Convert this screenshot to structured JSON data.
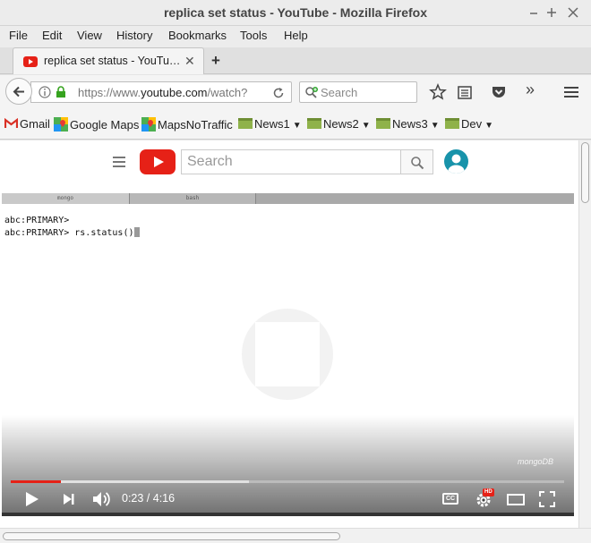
{
  "window": {
    "title": "replica set status - YouTube - Mozilla Firefox"
  },
  "menu": {
    "items": [
      "File",
      "Edit",
      "View",
      "History",
      "Bookmarks",
      "Tools",
      "Help"
    ]
  },
  "tab": {
    "label": "replica set status - YouTu…",
    "close": "✕",
    "new_tab": "+"
  },
  "nav": {
    "url_prefix": "https://www.",
    "url_host": "youtube.com",
    "url_rest": "/watch?",
    "search_placeholder": "Search",
    "overflow": "»"
  },
  "bookmarks": {
    "items": [
      "Gmail",
      "Google Maps",
      "MapsNoTraffic",
      "News1",
      "News2",
      "News3",
      "Dev"
    ]
  },
  "youtube": {
    "search_placeholder": "Search"
  },
  "terminal": {
    "tabs": [
      "mongo",
      "bash"
    ],
    "lines": [
      "abc:PRIMARY>",
      "abc:PRIMARY> rs.status()"
    ]
  },
  "player": {
    "current_time": "0:23",
    "duration": "4:16",
    "time_display": "0:23 / 4:16",
    "played_fraction": 0.09,
    "buffered_fraction": 0.43,
    "watermark": "mongoDB",
    "cc_label": "CC",
    "hd_label": "HD",
    "accent_color": "#e62117"
  }
}
